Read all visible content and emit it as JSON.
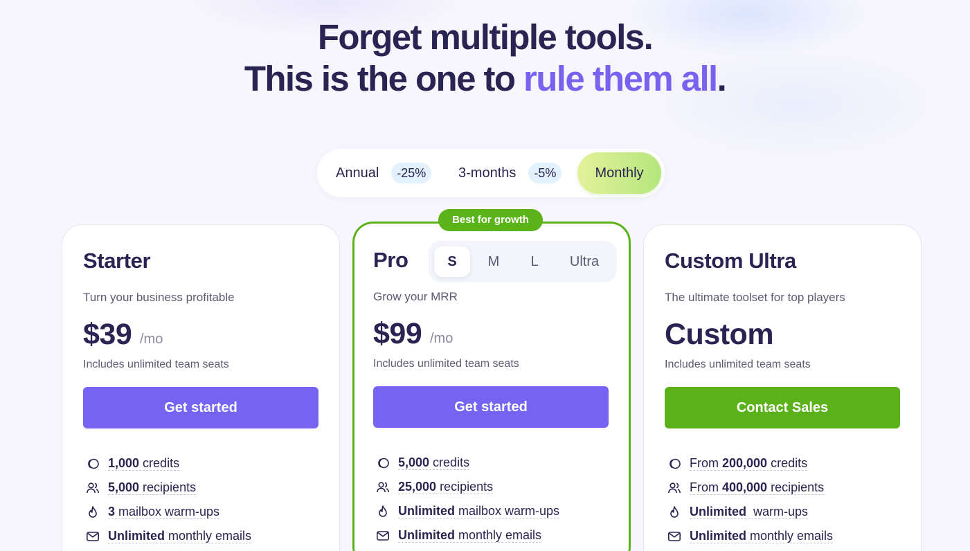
{
  "headline": {
    "line1": "Forget multiple tools.",
    "line2_prefix": "This is the one to ",
    "line2_accent": "rule them all",
    "line2_suffix": "."
  },
  "billing_toggle": {
    "annual": {
      "label": "Annual",
      "discount": "-25%"
    },
    "three_months": {
      "label": "3-months",
      "discount": "-5%"
    },
    "monthly": {
      "label": "Monthly",
      "selected": true
    }
  },
  "plans": [
    {
      "name": "Starter",
      "tagline": "Turn your business profitable",
      "price": "$39",
      "period": "/mo",
      "seats_note": "Includes unlimited team seats",
      "cta": "Get started",
      "features": [
        {
          "bold": "1,000",
          "rest": " credits"
        },
        {
          "bold": "5,000",
          "rest": " recipients"
        },
        {
          "bold": "3",
          "rest": " mailbox warm-ups"
        },
        {
          "bold": "Unlimited",
          "rest": " monthly emails"
        }
      ]
    },
    {
      "name": "Pro",
      "badge": "Best for growth",
      "sizes": [
        "S",
        "M",
        "L",
        "Ultra"
      ],
      "selected_size": "S",
      "tagline": "Grow your MRR",
      "price": "$99",
      "period": "/mo",
      "seats_note": "Includes unlimited team seats",
      "cta": "Get started",
      "features": [
        {
          "bold": "5,000",
          "rest": " credits"
        },
        {
          "bold": "25,000",
          "rest": " recipients"
        },
        {
          "bold": "Unlimited",
          "rest": " mailbox warm-ups"
        },
        {
          "bold": "Unlimited",
          "rest": " monthly emails"
        }
      ]
    },
    {
      "name": "Custom Ultra",
      "tagline": "The ultimate toolset for top players",
      "price": "Custom",
      "seats_note": "Includes unlimited team seats",
      "cta": "Contact Sales",
      "features": [
        {
          "prefix": "From ",
          "bold": "200,000",
          "rest": " credits"
        },
        {
          "prefix": "From ",
          "bold": "400,000",
          "rest": " recipients"
        },
        {
          "bold": "Unlimited",
          "rest": "  warm-ups"
        },
        {
          "bold": "Unlimited",
          "rest": " monthly emails"
        }
      ]
    }
  ],
  "feature_icons": [
    "coins-icon",
    "users-icon",
    "flame-icon",
    "mail-icon"
  ],
  "colors": {
    "heading": "#2a2453",
    "accent": "#7a62ef",
    "cta_purple": "#7663f1",
    "cta_green": "#5bb11a",
    "badge_green": "#5bb31a",
    "monthly_gradient_start": "#e3f19a",
    "monthly_gradient_end": "#b5e67e"
  }
}
